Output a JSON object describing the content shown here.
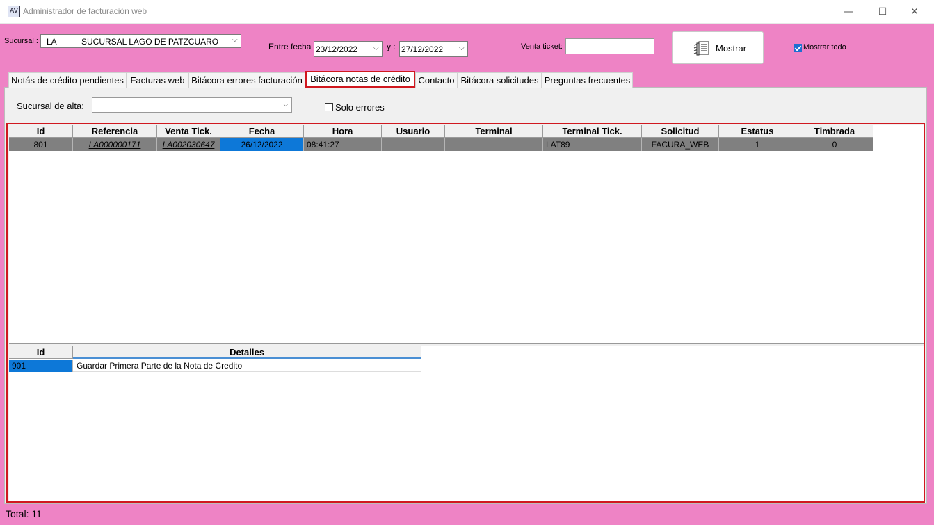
{
  "window": {
    "title": "Administrador de facturación web",
    "icon_text": "AV",
    "minimize": "—",
    "maximize": "☐",
    "close": "✕"
  },
  "toolbar": {
    "sucursal_label": "Sucursal :",
    "sucursal_code": "LA",
    "sucursal_name": "SUCURSAL LAGO DE PATZCUARO",
    "entre_fecha_label": "Entre fecha",
    "fecha_inicio": "23/12/2022",
    "y_label": "y :",
    "fecha_fin": "27/12/2022",
    "venta_ticket_label": "Venta ticket:",
    "venta_ticket_value": "",
    "mostrar_button": "Mostrar",
    "mostrar_todo_label": "Mostrar todo",
    "mostrar_todo_checked": true
  },
  "tabs": [
    {
      "label": "Notás de crédito pendientes"
    },
    {
      "label": "Facturas web"
    },
    {
      "label": "Bitácora errores facturación"
    },
    {
      "label": "Bitácora notas de crédito",
      "active": true
    },
    {
      "label": "Contacto"
    },
    {
      "label": "Bitácora solicitudes"
    },
    {
      "label": "Preguntas frecuentes"
    }
  ],
  "filters": {
    "sucursal_alta_label": "Sucursal de alta:",
    "sucursal_alta_value": "",
    "solo_errores_label": "Solo errores",
    "solo_errores_checked": false
  },
  "grid_main": {
    "columns": [
      "Id",
      "Referencia",
      "Venta Tick.",
      "Fecha",
      "Hora",
      "Usuario",
      "Terminal",
      "Terminal Tick.",
      "Solicitud",
      "Estatus",
      "Timbrada"
    ],
    "rows": [
      [
        "801",
        "LA000000171",
        "LA002030647",
        "26/12/2022",
        "08:41:27",
        "",
        "",
        "LAT89",
        "FACURA_WEB",
        "1",
        "0"
      ]
    ]
  },
  "grid_detail": {
    "columns": [
      "Id",
      "Detalles"
    ],
    "rows": [
      [
        "901",
        "Guardar Primera Parte de la Nota de Credito"
      ]
    ]
  },
  "status": {
    "total_text": "Total: 11"
  },
  "colors": {
    "background": "#ee83c5",
    "highlight_red": "#d0181f",
    "selection_blue": "#0d78d8",
    "row_gray": "#808080"
  }
}
